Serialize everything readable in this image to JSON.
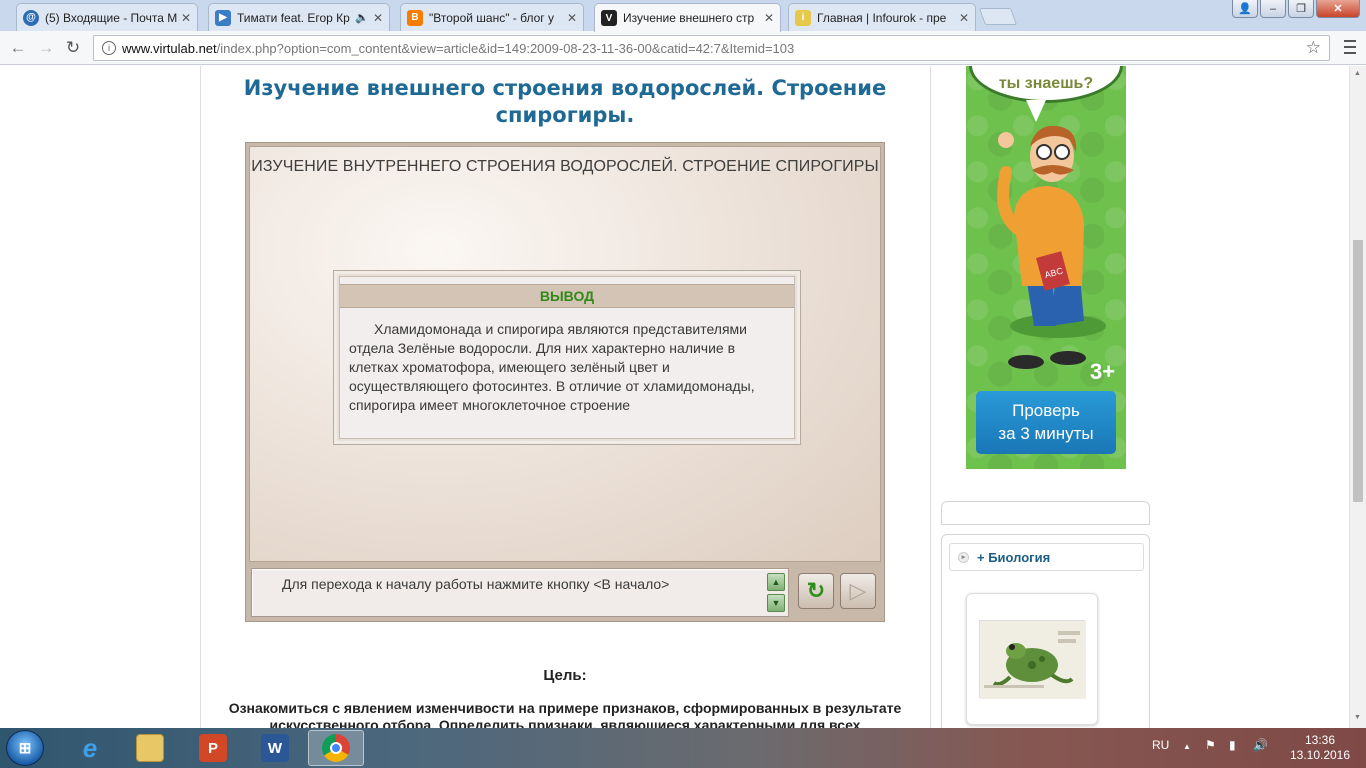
{
  "browser": {
    "tabs": [
      {
        "label": "(5) Входящие - Почта M",
        "favicon": "mail-icon",
        "color": "#2d6db5"
      },
      {
        "label": "Тимати feat. Егор Кр",
        "favicon": "video-icon",
        "color": "#3b7dc4",
        "audio": true
      },
      {
        "label": "\"Второй шанс\" - блог у",
        "favicon": "blogger-icon",
        "color": "#f57d00"
      },
      {
        "label": "Изучение внешнего стр",
        "favicon": "virtulab-icon",
        "color": "#222222",
        "active": true
      },
      {
        "label": "Главная | Infourok - пре",
        "favicon": "infourok-icon",
        "color": "#e6c94a"
      }
    ],
    "url_host": "www.virtulab.net",
    "url_rest": "/index.php?option=com_content&view=article&id=149:2009-08-23-11-36-00&catid=42:7&Itemid=103"
  },
  "article": {
    "title": "Изучение внешнего строения водорослей. Строение спирогиры."
  },
  "lab": {
    "heading": "ИЗУЧЕНИЕ ВНУТРЕННЕГО СТРОЕНИЯ ВОДОРОСЛЕЙ. СТРОЕНИЕ СПИРОГИРЫ",
    "dialog_title": "ВЫВОД",
    "dialog_text": "Хламидомонада и спирогира являются представителями отдела Зелёные водоросли. Для них характерно наличие в клетках хроматофора, имеющего зелёный цвет и осуществляющего фотосинтез. В отличие от хламидомонады, спирогира имеет многоклеточное строение",
    "message": "Для перехода к началу работы нажмите кнопку <В начало>"
  },
  "goal": {
    "title": "Цель:",
    "text": "Ознакомиться с явлением изменчивости на примере признаков, сформированных в результате искусственного отбора. Определить признаки, являющиеся характерными для всех"
  },
  "ad": {
    "bubble": "ты знаешь?",
    "age_badge": "3+",
    "book_label": "ABC",
    "button_line1": "Проверь",
    "button_line2": "за 3 минуты"
  },
  "sidebar": {
    "category": "+ Биология"
  },
  "taskbar": {
    "lang": "RU",
    "time": "13:36",
    "date": "13.10.2016"
  }
}
